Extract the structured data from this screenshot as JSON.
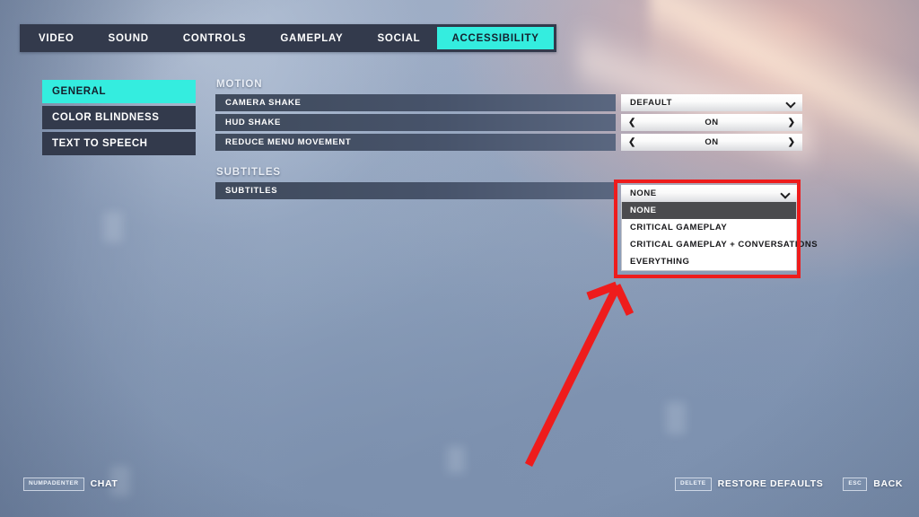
{
  "theme": {
    "accent": "#34eddf",
    "panel_dark": "#333a4c",
    "row_dark": "#47536a",
    "control_light": "#ffffff",
    "annotation_red": "#ee1c1c",
    "selected_option_bg": "#4b4b4e"
  },
  "tabs": [
    {
      "label": "VIDEO",
      "active": false
    },
    {
      "label": "SOUND",
      "active": false
    },
    {
      "label": "CONTROLS",
      "active": false
    },
    {
      "label": "GAMEPLAY",
      "active": false
    },
    {
      "label": "SOCIAL",
      "active": false
    },
    {
      "label": "ACCESSIBILITY",
      "active": true
    }
  ],
  "sidebar": {
    "items": [
      {
        "label": "GENERAL",
        "active": true
      },
      {
        "label": "COLOR BLINDNESS",
        "active": false
      },
      {
        "label": "TEXT TO SPEECH",
        "active": false
      }
    ]
  },
  "sections": [
    {
      "title": "MOTION",
      "rows": [
        {
          "label": "CAMERA SHAKE",
          "control": "select",
          "value": "DEFAULT",
          "icon": "chevron-down-icon"
        },
        {
          "label": "HUD SHAKE",
          "control": "stepper",
          "value": "ON",
          "prev_icon": "chevron-left-icon",
          "next_icon": "chevron-right-icon"
        },
        {
          "label": "REDUCE MENU MOVEMENT",
          "control": "stepper",
          "value": "ON",
          "prev_icon": "chevron-left-icon",
          "next_icon": "chevron-right-icon"
        }
      ]
    },
    {
      "title": "SUBTITLES",
      "rows": [
        {
          "label": "SUBTITLES",
          "control": "select-open",
          "value": "NONE",
          "icon": "chevron-down-icon"
        }
      ]
    }
  ],
  "dropdown": {
    "selected": "NONE",
    "icon": "chevron-down-icon",
    "options": [
      {
        "label": "NONE",
        "selected": true
      },
      {
        "label": "CRITICAL GAMEPLAY",
        "selected": false
      },
      {
        "label": "CRITICAL GAMEPLAY + CONVERSATIONS",
        "selected": false
      },
      {
        "label": "EVERYTHING",
        "selected": false
      }
    ]
  },
  "annotation": {
    "type": "arrow",
    "color": "#ee1c1c",
    "points_to": "subtitles-dropdown-list",
    "highlight_box": "subtitles-dropdown"
  },
  "hints": {
    "left": [
      {
        "key": "NUMPADENTER",
        "label": "CHAT"
      }
    ],
    "right": [
      {
        "key": "DELETE",
        "label": "RESTORE DEFAULTS"
      },
      {
        "key": "ESC",
        "label": "BACK"
      }
    ]
  }
}
